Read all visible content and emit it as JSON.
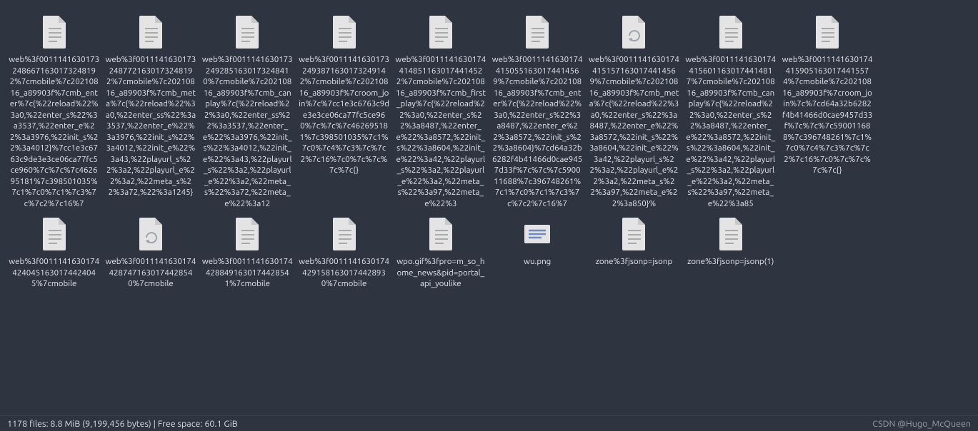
{
  "status": {
    "left": "1178 files: 8.8 MiB (9,199,456 bytes)  |  Free space: 60.1 GiB",
    "watermark": "CSDN @Hugo_McQueen"
  },
  "files": [
    {
      "icon": "text",
      "name": "web%3f00111416301732486671630173248192%7cmobile%7c20210816_a89903f%7cmb_enter%7c{%22reload%22%3a0,%22enter_s%22%3a3537,%22enter_e%22%3a3976,%22init_s%22%3a4012}%7cc1e3c6763c9de3e3ce06ca77fc5ce960%7c%7c%7c462695181%7c398501035%7c1%7c0%7c1%7c3%7c%7c2%7c16%7"
    },
    {
      "icon": "text",
      "name": "web%3f00111416301732487721630173248192%7cmobile%7c20210816_a89903f%7cmb_meta%7c{%22reload%22%3a0,%22enter_ss%22%3a3537,%22enter_e%22%3a3976,%22init_s%22%3a4012,%22init_e%22%3a43,%22playurl_s%22%3a2,%22playurl_e%22%3a2,%22meta_s%22%3a72,%22%3a1245}"
    },
    {
      "icon": "text",
      "name": "web%3f00111416301732492851630173248410%7cmobile%7c20210816_a89903f%7cmb_canplay%7c{%22reload%22%3a0,%22enter_ss%22%3a3537,%22enter_e%22%3a3976,%22init_s%22%3a4012,%22init_e%22%3a43,%22playurl_s%22%3a2,%22playurl_e%22%3a2,%22meta_s%22%3a72,%22meta_e%22%3a12"
    },
    {
      "icon": "text",
      "name": "web%3f00111416301732493871630173249142%7cmobile%7c20210816_a89903f%7croom_join%7c%7cc1e3c6763c9de3e3ce06ca77fc5ce960%7c%7c%7c462695181%7c398501035%7c1%7c0%7c4%7c3%7c%7c2%7c16%7c0%7c%7c%7c%7c{}"
    },
    {
      "icon": "text",
      "name": "web%3f00111416301744148511630174414522%7cmobile%7c20210816_a89903f%7cmb_first_play%7c{%22reload%22%3a0,%22enter_s%22%3a8487,%22enter_e%22%3a8572,%22init_s%22%3a8604,%22init_e%22%3a42,%22playurl_s%22%3a2,%22playurl_e%22%3a2,%22meta_s%22%3a97,%22meta_e%22%3"
    },
    {
      "icon": "text",
      "name": "web%3f00111416301744150551630174414569%7cmobile%7c20210816_a89903f%7cmb_enter%7c{%22reload%22%3a0,%22enter_s%22%3a8487,%22enter_e%22%3a8572,%22init_s%22%3a8604}%7cd64a32b6282f4b41466d0cae9457d33f%7c%7c%7c590011688%7c396748261%7c1%7c0%7c1%7c3%7c%7c2%7c16%7"
    },
    {
      "icon": "recycle",
      "name": "web%3f00111416301744151571630174414569%7cmobile%7c20210816_a89903f%7cmb_meta%7c{%22reload%22%3a0,%22enter_s%22%3a8487,%22enter_e%22%3a8572,%22init_s%22%3a8604,%22init_e%22%3a42,%22playurl_s%22%3a2,%22playurl_e%22%3a2,%22meta_s%22%3a97,%22meta_e%22%3a850}%"
    },
    {
      "icon": "text",
      "name": "web%3f00111416301744156011630174414817%7cmobile%7c20210816_a89903f%7cmb_canplay%7c{%22reload%22%3a0,%22enter_s%22%3a8487,%22enter_e%22%3a8572,%22init_s%22%3a8604,%22init_e%22%3a42,%22playurl_s%22%3a2,%22playurl_e%22%3a2,%22meta_s%22%3a97,%22meta_e%22%3a85"
    },
    {
      "icon": "text",
      "name": "web%3f00111416301744159051630174415574%7cmobile%7c20210816_a89903f%7croom_join%7c%7cd64a32b6282f4b41466d0cae9457d33f%7c%7c%7c590011688%7c396748261%7c1%7c0%7c4%7c3%7c%7c2%7c16%7c0%7c%7c%7c%7c{}"
    },
    null,
    {
      "icon": "text",
      "name": "web%3f00111416301744240451630174424045%7cmobile"
    },
    {
      "icon": "recycle",
      "name": "web%3f00111416301744287471630174428540%7cmobile"
    },
    {
      "icon": "text",
      "name": "web%3f00111416301744288491630174428541%7cmobile"
    },
    {
      "icon": "text",
      "name": "web%3f00111416301744291581630174428930%7cmobile"
    },
    {
      "icon": "text",
      "name": "wpo.gif%3fpro=m_so_home_news&pid=portal_api_youlike"
    },
    {
      "icon": "image",
      "name": "wu.png"
    },
    {
      "icon": "text",
      "name": "zone%3fjsonp=jsonp"
    },
    {
      "icon": "text",
      "name": "zone%3fjsonp=jsonp(1)"
    }
  ]
}
